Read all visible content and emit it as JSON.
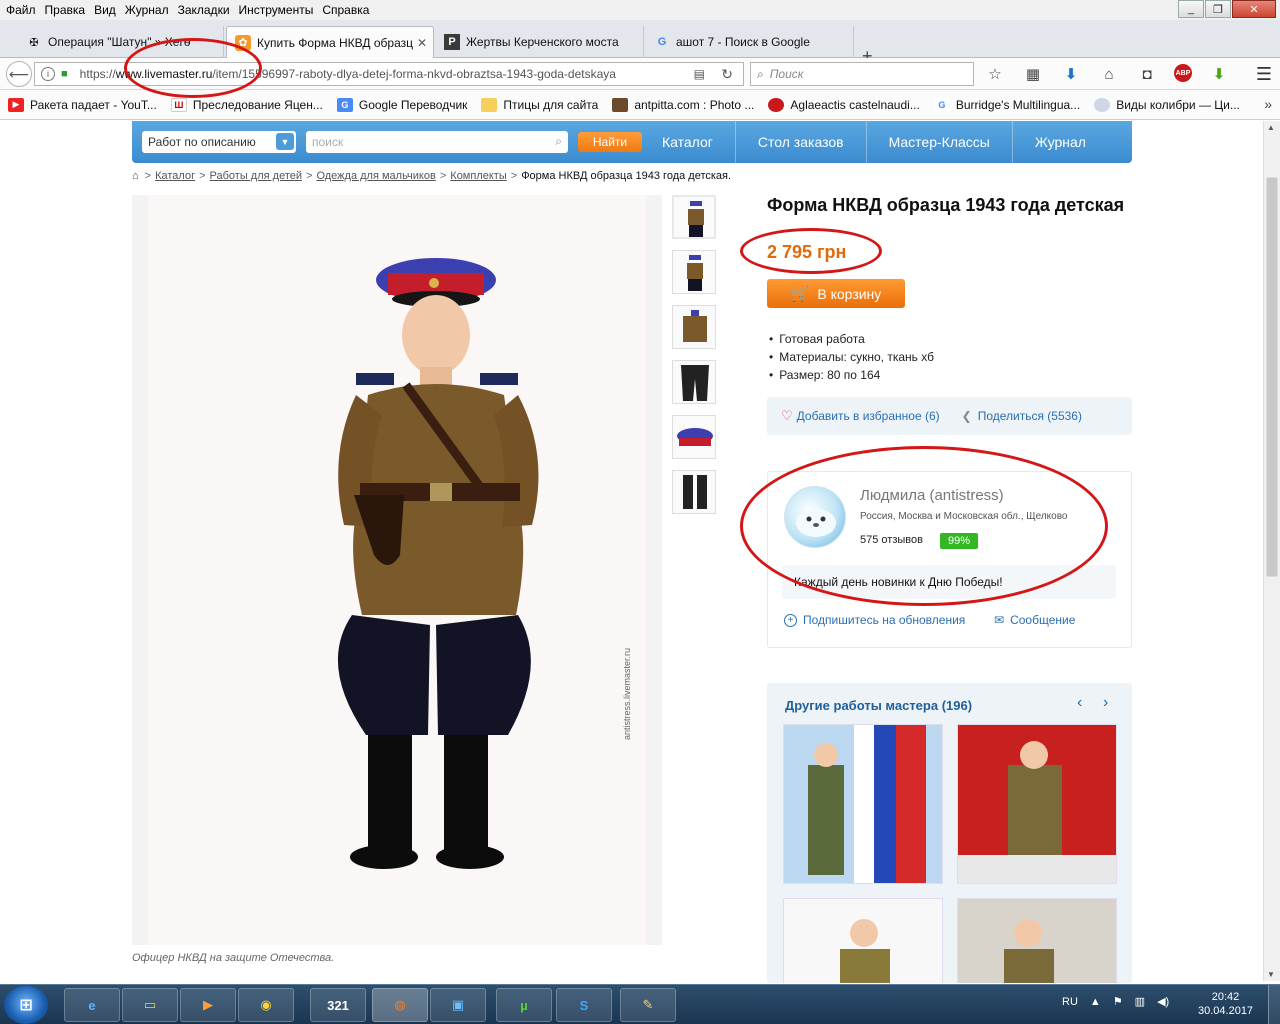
{
  "browser": {
    "menu": [
      "Файл",
      "Правка",
      "Вид",
      "Журнал",
      "Закладки",
      "Инструменты",
      "Справка"
    ],
    "tabs": [
      {
        "label": "Операция \"Шатун\" » Хегѳ"
      },
      {
        "label": "Купить Форма НКВД образц"
      },
      {
        "label": "Жертвы Керченского моста"
      },
      {
        "label": "ашот 7 - Поиск в Google"
      }
    ],
    "new_tab": "+",
    "url_prefix": "https://",
    "url_domain": "www.livemaster.ru",
    "url_rest": "/item/15596997-raboty-dlya-detej-forma-nkvd-obraztsa-1943-goda-detskaya",
    "search_placeholder": "Поиск",
    "bookmarks": [
      {
        "label": "Ракета падает - YouT..."
      },
      {
        "label": "Преследование Яцен..."
      },
      {
        "label": "Google Переводчик"
      },
      {
        "label": "Птицы для сайта"
      },
      {
        "label": "antpitta.com : Photo ..."
      },
      {
        "label": "Aglaeactis castelnaudi..."
      },
      {
        "label": "Burridge's Multilingua..."
      },
      {
        "label": "Виды колибри — Ци..."
      }
    ],
    "bookmarks_more": "»"
  },
  "site": {
    "select_label": "Работ по описанию",
    "search_placeholder": "поиск",
    "find_button": "Найти",
    "nav": [
      "Каталог",
      "Стол заказов",
      "Мастер-Классы",
      "Журнал"
    ]
  },
  "breadcrumbs": {
    "items": [
      "Каталог",
      "Работы для детей",
      "Одежда для мальчиков",
      "Комплекты"
    ],
    "current": "Форма НКВД образца 1943 года детская.",
    "sep": ">"
  },
  "product": {
    "title": "Форма НКВД образца 1943 года детская",
    "price": "2 795 грн",
    "cart_button": "В корзину",
    "features": [
      "Готовая работа",
      "Материалы: сукно, ткань хб",
      "Размер: 80 по 164"
    ],
    "favorite": "Добавить в избранное (6)",
    "share": "Поделиться (5536)",
    "photo_caption": "Офицер НКВД на защите Отечества.",
    "watermark": "antistress.livemaster.ru"
  },
  "master": {
    "name": "Людмила (antistress)",
    "location": "Россия, Москва и Московская обл., Щелково",
    "reviews": "575 отзывов",
    "rating": "99%",
    "news": "Каждый день новинки к Дню Победы!",
    "subscribe": "Подпишитесь на обновления",
    "message": "Сообщение"
  },
  "other_works": {
    "title": "Другие работы мастера (196)",
    "prev": "‹",
    "next": "›"
  },
  "taskbar": {
    "lang": "RU",
    "time": "20:42",
    "date": "30.04.2017"
  },
  "colors": {
    "accent_blue": "#3b8bd0",
    "price_orange": "#e06b0c",
    "annotation_red": "#d41616"
  }
}
